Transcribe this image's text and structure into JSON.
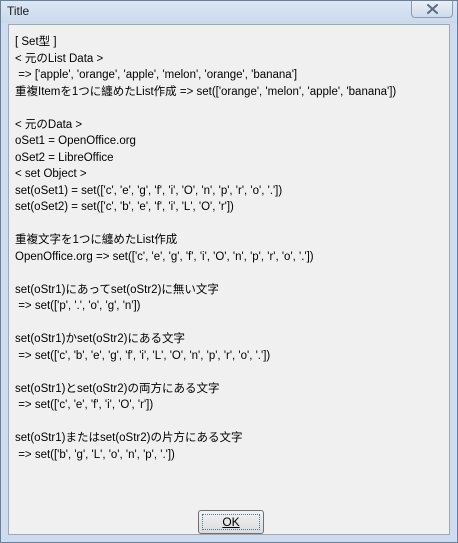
{
  "window": {
    "title": "Title"
  },
  "content": {
    "lines": [
      "[ Set型 ]",
      "< 元のList Data >",
      " => ['apple', 'orange', 'apple', 'melon', 'orange', 'banana']",
      "重複Itemを1つに纏めたList作成 => set(['orange', 'melon', 'apple', 'banana'])",
      "",
      "< 元のData >",
      "oSet1 = OpenOffice.org",
      "oSet2 = LibreOffice",
      "< set Object >",
      "set(oSet1) = set(['c', 'e', 'g', 'f', 'i', 'O', 'n', 'p', 'r', 'o', '.'])",
      "set(oSet2) = set(['c', 'b', 'e', 'f', 'i', 'L', 'O', 'r'])",
      "",
      "重複文字を1つに纏めたList作成",
      "OpenOffice.org => set(['c', 'e', 'g', 'f', 'i', 'O', 'n', 'p', 'r', 'o', '.'])",
      "",
      "set(oStr1)にあってset(oStr2)に無い文字",
      " => set(['p', '.', 'o', 'g', 'n'])",
      "",
      "set(oStr1)かset(oStr2)にある文字",
      " => set(['c', 'b', 'e', 'g', 'f', 'i', 'L', 'O', 'n', 'p', 'r', 'o', '.'])",
      "",
      "set(oStr1)とset(oStr2)の両方にある文字",
      " => set(['c', 'e', 'f', 'i', 'O', 'r'])",
      "",
      "set(oStr1)またはset(oStr2)の片方にある文字",
      " => set(['b', 'g', 'L', 'o', 'n', 'p', '.'])"
    ]
  },
  "buttons": {
    "ok_label": "OK"
  },
  "icons": {
    "close": "close-icon"
  }
}
